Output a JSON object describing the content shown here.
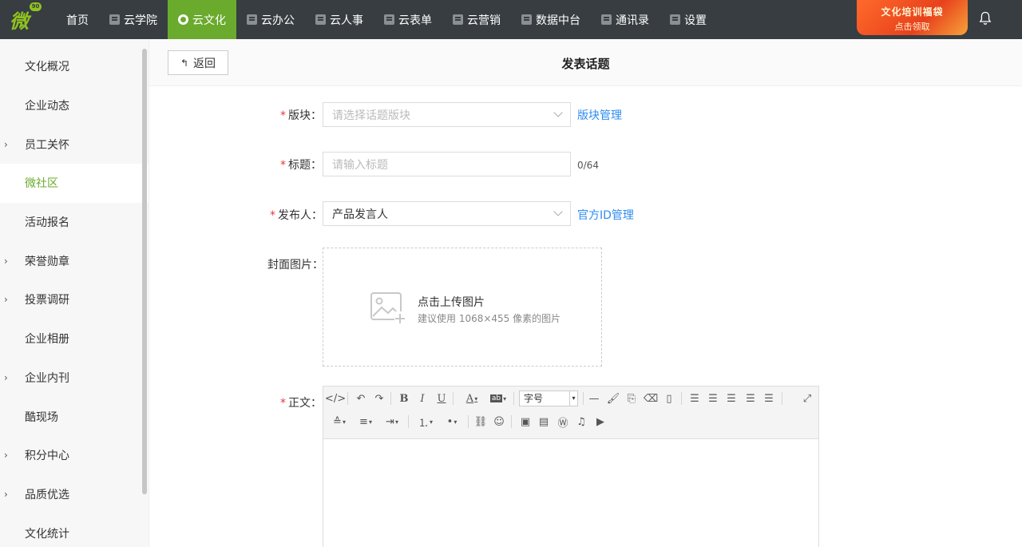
{
  "topbar": {
    "logo": {
      "char": "微",
      "badge": "90"
    },
    "nav": [
      {
        "label": "首页",
        "icon": "",
        "active": false
      },
      {
        "label": "云学院",
        "icon": "video-icon",
        "active": false
      },
      {
        "label": "云文化",
        "icon": "gear-icon",
        "active": true
      },
      {
        "label": "云办公",
        "icon": "briefcase-icon",
        "active": false
      },
      {
        "label": "云人事",
        "icon": "id-card-icon",
        "active": false
      },
      {
        "label": "云表单",
        "icon": "form-icon",
        "active": false
      },
      {
        "label": "云营销",
        "icon": "chart-icon",
        "active": false
      },
      {
        "label": "数据中台",
        "icon": "cube-icon",
        "active": false
      },
      {
        "label": "通讯录",
        "icon": "contact-icon",
        "active": false
      },
      {
        "label": "设置",
        "icon": "grid-icon",
        "active": false
      }
    ],
    "banner": {
      "line1": "文化培训福袋",
      "line2": "点击领取"
    }
  },
  "sidebar": {
    "items": [
      {
        "label": "文化概况",
        "expandable": false,
        "active": false
      },
      {
        "label": "企业动态",
        "expandable": false,
        "active": false
      },
      {
        "label": "员工关怀",
        "expandable": true,
        "active": false
      },
      {
        "label": "微社区",
        "expandable": false,
        "active": true
      },
      {
        "label": "活动报名",
        "expandable": false,
        "active": false
      },
      {
        "label": "荣誉勋章",
        "expandable": true,
        "active": false
      },
      {
        "label": "投票调研",
        "expandable": true,
        "active": false
      },
      {
        "label": "企业相册",
        "expandable": false,
        "active": false
      },
      {
        "label": "企业内刊",
        "expandable": true,
        "active": false
      },
      {
        "label": "酷现场",
        "expandable": false,
        "active": false
      },
      {
        "label": "积分中心",
        "expandable": true,
        "active": false
      },
      {
        "label": "品质优选",
        "expandable": true,
        "active": false
      },
      {
        "label": "文化统计",
        "expandable": false,
        "active": false
      }
    ]
  },
  "header": {
    "back_label": "返回",
    "title": "发表话题"
  },
  "form": {
    "section": {
      "label": "版块",
      "placeholder": "请选择话题版块",
      "link": "版块管理",
      "required": true
    },
    "title": {
      "label": "标题",
      "placeholder": "请输入标题",
      "value": "",
      "counter": "0/64",
      "required": true
    },
    "publisher": {
      "label": "发布人",
      "value": "产品发言人",
      "link": "官方ID管理",
      "required": true
    },
    "cover": {
      "label": "封面图片",
      "upload_text": "点击上传图片",
      "hint": "建议使用 1068×455 像素的图片"
    },
    "body": {
      "label": "正文",
      "font_size_placeholder": "字号",
      "required": true
    },
    "colon": "："
  }
}
